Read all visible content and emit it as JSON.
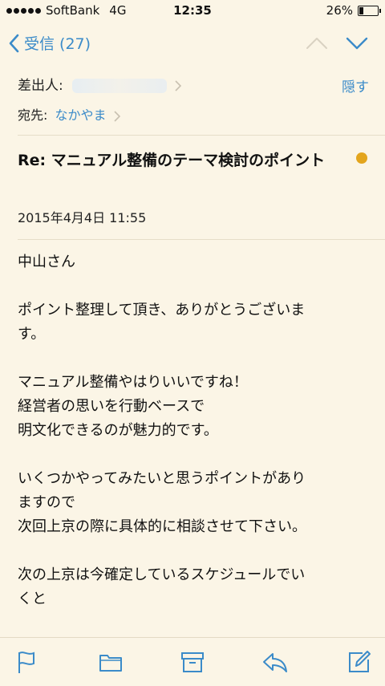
{
  "status": {
    "carrier": "SoftBank",
    "network": "4G",
    "time": "12:35",
    "battery_text": "26%",
    "battery_level": 0.26
  },
  "nav": {
    "back_label": "受信 (27)",
    "icons": [
      "chevron-left-icon",
      "chevron-up-icon",
      "chevron-down-icon"
    ]
  },
  "header": {
    "from_label": "差出人:",
    "to_label": "宛先:",
    "to_name": "なかやま",
    "hide_label": "隠す"
  },
  "message": {
    "subject": "Re: マニュアル整備のテーマ検討のポイント",
    "date": "2015年4月4日 11:55",
    "paragraphs": [
      {
        "lines": [
          "中山さん"
        ]
      },
      {
        "lines": [
          "ポイント整理して頂き、ありがとうございま",
          "す。"
        ]
      },
      {
        "lines": [
          "マニュアル整備やはりいいですね！",
          "経営者の思いを行動ベースで",
          "明文化できるのが魅力的です。"
        ]
      },
      {
        "lines": [
          "いくつかやってみたいと思うポイントがあり",
          "ますので",
          "次回上京の際に具体的に相談させて下さい。"
        ]
      },
      {
        "lines": [
          "次の上京は今確定しているスケジュールでい",
          "くと"
        ]
      }
    ]
  },
  "toolbar": {
    "icons": [
      "flag-icon",
      "folder-icon",
      "archive-icon",
      "reply-icon",
      "compose-icon"
    ]
  },
  "colors": {
    "background": "#fbf5e6",
    "accent": "#3b8bc9",
    "unread_dot": "#e3a51d"
  }
}
